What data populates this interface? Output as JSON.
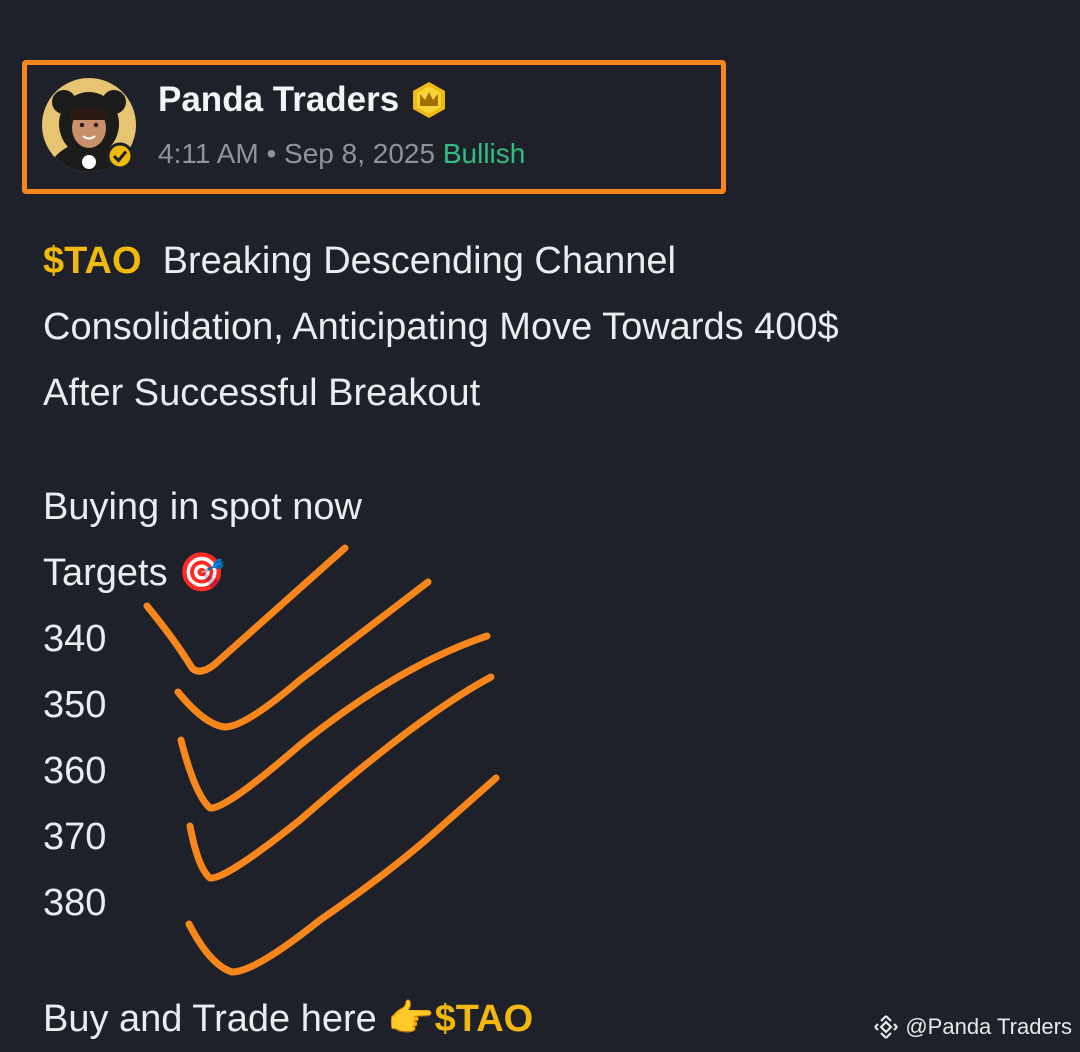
{
  "post": {
    "author": {
      "name": "Panda Traders",
      "badge_icon": "crown-badge-icon",
      "verified_icon": "verified-check-icon"
    },
    "time": "4:11 AM",
    "separator": "•",
    "date": "Sep 8, 2025",
    "sentiment": "Bullish",
    "ticker": "$TAO",
    "headline_lines": [
      "Breaking Descending Channel",
      "Consolidation, Anticipating Move Towards 400$",
      "After Successful Breakout"
    ],
    "buying_line": "Buying in spot now",
    "targets_label": "Targets",
    "targets_icon": "🎯",
    "targets": [
      "340",
      "350",
      "360",
      "370",
      "380"
    ],
    "cta_text": "Buy and Trade here",
    "cta_icon": "👉",
    "cta_ticker": "$TAO"
  },
  "watermark": {
    "text": "@Panda Traders",
    "icon": "binance-logo-icon"
  },
  "colors": {
    "background": "#1e2129",
    "highlight_box": "#f7861c",
    "ticker": "#f0b90b",
    "bullish": "#2ebd85",
    "annotation": "#f7861c"
  }
}
